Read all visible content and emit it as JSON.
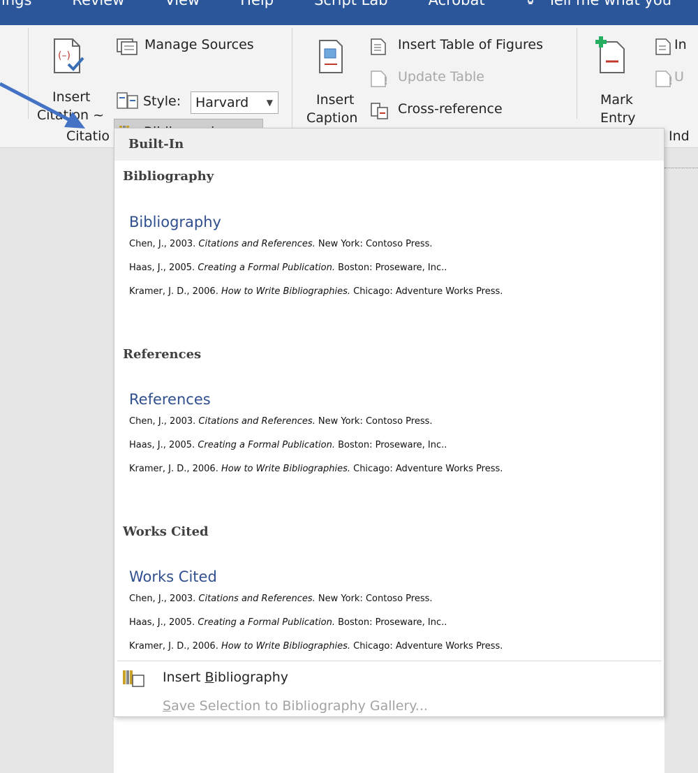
{
  "titlebar": {
    "tabs": [
      "ings",
      "Review",
      "View",
      "Help",
      "Script Lab",
      "Acrobat"
    ],
    "tell_me": "Tell me what you"
  },
  "ribbon": {
    "insert_citation": {
      "line1": "Insert",
      "line2": "Citation ~"
    },
    "manage_sources": "Manage Sources",
    "style_label": "Style:",
    "style_value": "Harvard",
    "bibliography": "Bibliography ~",
    "group_citations": "Citatio",
    "insert_caption": {
      "line1": "Insert",
      "line2": "Caption"
    },
    "insert_table_of_figures": "Insert Table of Figures",
    "update_table": "Update Table",
    "cross_reference": "Cross-reference",
    "mark_entry": {
      "line1": "Mark",
      "line2": "Entry"
    },
    "insert_index_partial": "In",
    "update_index_partial": "U",
    "group_index": "Ind"
  },
  "dropdown": {
    "header": "Built-In",
    "sections": [
      {
        "title": "Bibliography",
        "heading": "Bibliography",
        "entries": [
          {
            "pre": "Chen, J., 2003. ",
            "ital": "Citations and References.",
            "post": " New York: Contoso Press."
          },
          {
            "pre": "Haas, J., 2005. ",
            "ital": "Creating a Formal Publication.",
            "post": " Boston: Proseware, Inc.."
          },
          {
            "pre": "Kramer, J. D., 2006. ",
            "ital": "How to Write Bibliographies.",
            "post": " Chicago: Adventure Works Press."
          }
        ]
      },
      {
        "title": "References",
        "heading": "References",
        "entries": [
          {
            "pre": "Chen, J., 2003. ",
            "ital": "Citations and References.",
            "post": " New York: Contoso Press."
          },
          {
            "pre": "Haas, J., 2005. ",
            "ital": "Creating a Formal Publication.",
            "post": " Boston: Proseware, Inc.."
          },
          {
            "pre": "Kramer, J. D., 2006. ",
            "ital": "How to Write Bibliographies.",
            "post": " Chicago: Adventure Works Press."
          }
        ]
      },
      {
        "title": "Works Cited",
        "heading": "Works Cited",
        "entries": [
          {
            "pre": "Chen, J., 2003. ",
            "ital": "Citations and References.",
            "post": " New York: Contoso Press."
          },
          {
            "pre": "Haas, J., 2005. ",
            "ital": "Creating a Formal Publication.",
            "post": " Boston: Proseware, Inc.."
          },
          {
            "pre": "Kramer, J. D., 2006. ",
            "ital": "How to Write Bibliographies.",
            "post": " Chicago: Adventure Works Press."
          }
        ]
      }
    ],
    "insert_bibliography": {
      "pre": "Insert ",
      "u": "B",
      "post": "ibliography"
    },
    "save_selection": {
      "pre": "",
      "u": "S",
      "post": "ave Selection to Bibliography Gallery..."
    }
  },
  "colors": {
    "titlebar": "#2b579a",
    "arrow": "#4472c4",
    "gallery_heading": "#2f4f8e"
  }
}
